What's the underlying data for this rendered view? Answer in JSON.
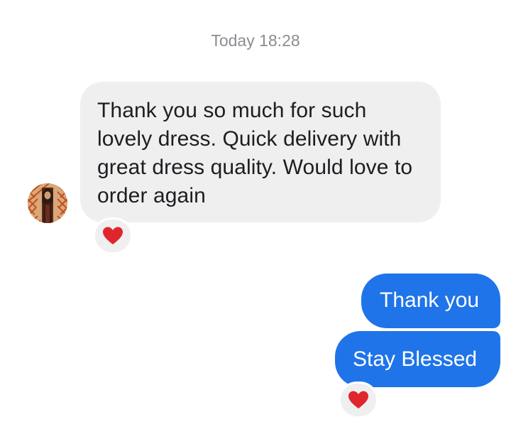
{
  "conversation": {
    "timestamp": "Today 18:28"
  },
  "messages": [
    {
      "direction": "incoming",
      "text": "Thank you so much for such lovely dress. Quick delivery with great dress quality. Would love to order again",
      "reaction": "heart-icon"
    },
    {
      "direction": "outgoing",
      "text": "Thank you"
    },
    {
      "direction": "outgoing",
      "text": "Stay Blessed",
      "reaction": "heart-icon"
    }
  ],
  "colors": {
    "incoming_bubble": "#efefef",
    "outgoing_bubble": "#1f74e9",
    "timestamp_text": "#8a8d91",
    "heart": "#e0262c"
  }
}
